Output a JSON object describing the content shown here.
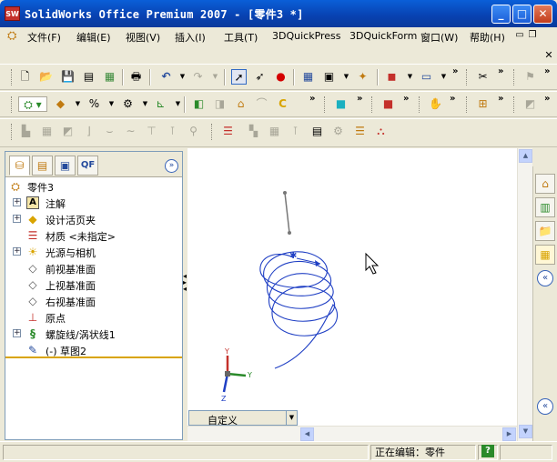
{
  "window": {
    "title": "SolidWorks Office Premium 2007 - [零件3 *]",
    "logo_text": "SW",
    "minimize_glyph": "_",
    "maximize_glyph": "□",
    "close_glyph": "✕"
  },
  "menubar": {
    "items": [
      {
        "label": "文件(F)"
      },
      {
        "label": "编辑(E)"
      },
      {
        "label": "视图(V)"
      },
      {
        "label": "插入(I)"
      },
      {
        "label": "工具(T)"
      },
      {
        "label": "3DQuickPress"
      },
      {
        "label": "3DQuickForm"
      },
      {
        "label": "窗口(W)"
      },
      {
        "label": "帮助(H)"
      }
    ],
    "doc_minimize": "▭",
    "doc_restore": "❐",
    "doc_close": "✕"
  },
  "panel": {
    "tabs": [
      {
        "name": "featuremanager-tab",
        "glyph": "⛁"
      },
      {
        "name": "propertymanager-tab",
        "glyph": "▤"
      },
      {
        "name": "configurationmanager-tab",
        "glyph": "▣"
      },
      {
        "name": "quickform-tab",
        "glyph": "QF"
      }
    ],
    "collapse_glyph": "»",
    "tree": [
      {
        "label": "零件3",
        "icon": "part-icon",
        "glyph": "⛭",
        "expander": ""
      },
      {
        "label": "注解",
        "icon": "annotations-icon",
        "glyph": "A",
        "expander": "+"
      },
      {
        "label": "设计活页夹",
        "icon": "design-binder-icon",
        "glyph": "◆",
        "expander": "+"
      },
      {
        "label": "材质 <未指定>",
        "icon": "material-icon",
        "glyph": "☰",
        "expander": ""
      },
      {
        "label": "光源与相机",
        "icon": "lights-cameras-icon",
        "glyph": "☀",
        "expander": "+"
      },
      {
        "label": "前视基准面",
        "icon": "plane-icon",
        "glyph": "◇",
        "expander": ""
      },
      {
        "label": "上视基准面",
        "icon": "plane-icon",
        "glyph": "◇",
        "expander": ""
      },
      {
        "label": "右视基准面",
        "icon": "plane-icon",
        "glyph": "◇",
        "expander": ""
      },
      {
        "label": "原点",
        "icon": "origin-icon",
        "glyph": "⊥",
        "expander": ""
      },
      {
        "label": "螺旋线/涡状线1",
        "icon": "helix-icon",
        "glyph": "§",
        "expander": "+"
      },
      {
        "label": "(-) 草图2",
        "icon": "sketch-icon",
        "glyph": "✎",
        "expander": ""
      }
    ]
  },
  "viewport": {
    "configuration": "自定义",
    "triad": {
      "x": "Y",
      "y": "Y",
      "z": "Z"
    },
    "helix_color": "#1f3fc4"
  },
  "taskpane": {
    "buttons": [
      {
        "name": "home-icon",
        "glyph": "⌂"
      },
      {
        "name": "resources-icon",
        "glyph": "▥"
      },
      {
        "name": "design-library-icon",
        "glyph": "📁"
      },
      {
        "name": "file-explorer-icon",
        "glyph": "▦"
      }
    ],
    "expand_glyph": "«"
  },
  "statusbar": {
    "status": "正在编辑：零件",
    "help_glyph": "?"
  }
}
